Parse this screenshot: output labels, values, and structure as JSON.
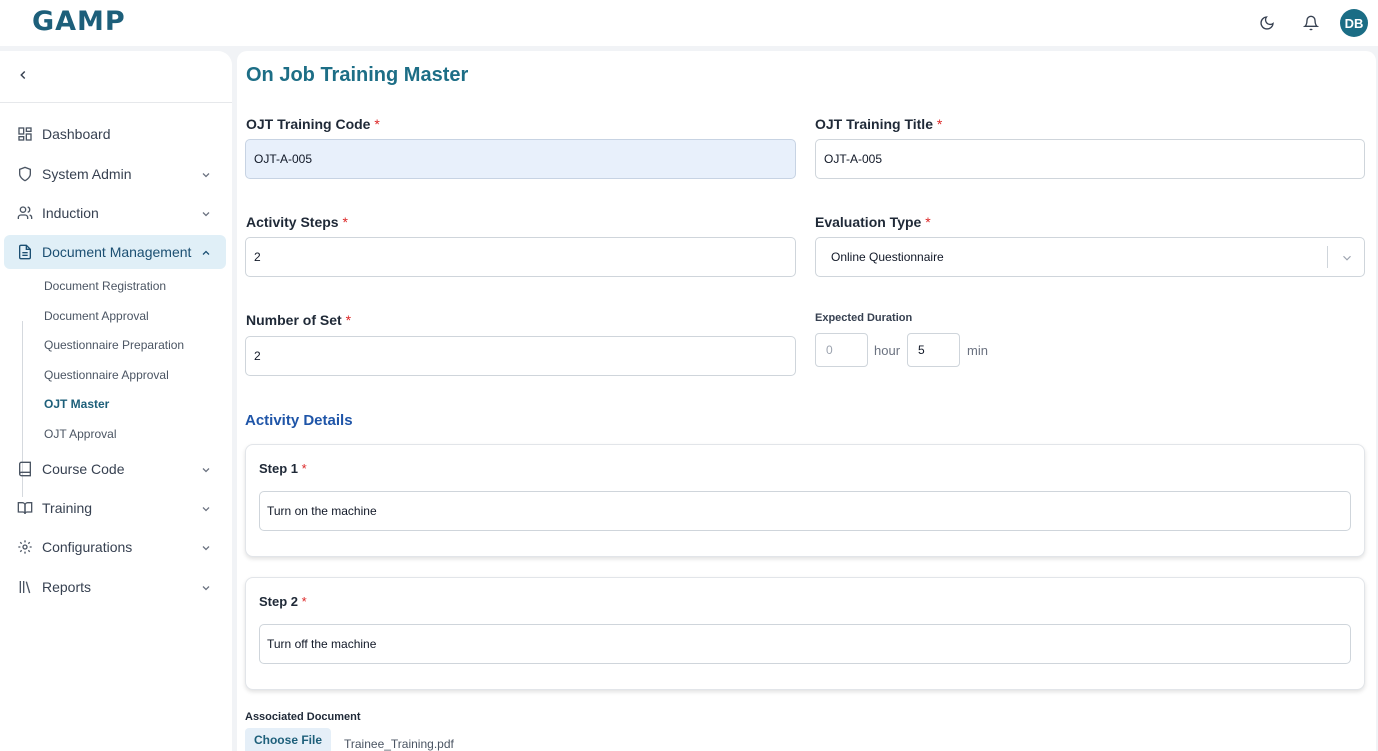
{
  "header": {
    "logo": "GAMP",
    "avatar_initials": "DB",
    "icons": [
      "moon-icon",
      "bell-icon"
    ]
  },
  "sidebar": {
    "items": [
      {
        "label": "Dashboard",
        "icon": "dashboard-icon"
      },
      {
        "label": "System Admin",
        "icon": "shield-icon"
      },
      {
        "label": "Induction",
        "icon": "users-icon"
      },
      {
        "label": "Document Management",
        "icon": "document-icon"
      },
      {
        "label": "Course Code",
        "icon": "book-icon"
      },
      {
        "label": "Training",
        "icon": "open-book-icon"
      },
      {
        "label": "Configurations",
        "icon": "gear-icon"
      },
      {
        "label": "Reports",
        "icon": "library-icon"
      }
    ],
    "sub_items": [
      "Document Registration",
      "Document Approval",
      "Questionnaire Preparation",
      "Questionnaire Approval",
      "OJT Master",
      "OJT Approval"
    ]
  },
  "form": {
    "title": "On Job Training Master",
    "required_mark": "*",
    "code_label": "OJT Training Code",
    "code_value": "OJT-A-005",
    "title_label": "OJT Training Title",
    "title_value": "OJT-A-005",
    "steps_label": "Activity Steps",
    "steps_value": "2",
    "eval_label": "Evaluation Type",
    "eval_value": "Online Questionnaire",
    "sets_label": "Number of Set",
    "sets_value": "2",
    "duration_label": "Expected Duration",
    "hours_value": "0",
    "hour_unit": "hour",
    "minutes_value": "5",
    "min_unit": "min"
  },
  "activity": {
    "section_title": "Activity Details",
    "steps": [
      {
        "label": "Step 1",
        "value": "Turn on the machine"
      },
      {
        "label": "Step 2",
        "value": "Turn off the machine"
      }
    ]
  },
  "attachment": {
    "label": "Associated Document",
    "button_label": "Choose File",
    "file_name": "Trainee_Training.pdf"
  },
  "colors": {
    "brand": "#1d6e86",
    "active_bg": "#e0eff7",
    "required": "#dc2626",
    "section": "#1f55a8"
  }
}
